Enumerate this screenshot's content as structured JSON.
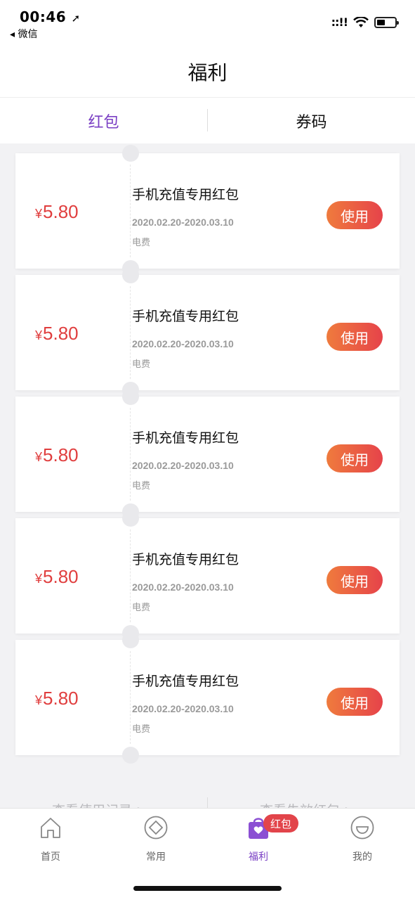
{
  "status_bar": {
    "time": "00:46",
    "location_arrow": "➚",
    "back_app": "◂ 微信",
    "signal": "::!!",
    "wifi": "wifi-icon",
    "battery": "battery-icon"
  },
  "header": {
    "title": "福利"
  },
  "tabs": [
    {
      "label": "红包",
      "active": true
    },
    {
      "label": "券码",
      "active": false
    }
  ],
  "coupons": [
    {
      "currency": "¥",
      "amount": "5.80",
      "title": "手机充值专用红包",
      "date_range": "2020.02.20-2020.03.10",
      "category": "电费",
      "action": "使用"
    },
    {
      "currency": "¥",
      "amount": "5.80",
      "title": "手机充值专用红包",
      "date_range": "2020.02.20-2020.03.10",
      "category": "电费",
      "action": "使用"
    },
    {
      "currency": "¥",
      "amount": "5.80",
      "title": "手机充值专用红包",
      "date_range": "2020.02.20-2020.03.10",
      "category": "电费",
      "action": "使用"
    },
    {
      "currency": "¥",
      "amount": "5.80",
      "title": "手机充值专用红包",
      "date_range": "2020.02.20-2020.03.10",
      "category": "电费",
      "action": "使用"
    },
    {
      "currency": "¥",
      "amount": "5.80",
      "title": "手机充值专用红包",
      "date_range": "2020.02.20-2020.03.10",
      "category": "电费",
      "action": "使用"
    }
  ],
  "bottom_links": {
    "left": "查看使用记录 >",
    "right": "查看失效红包 >"
  },
  "tabbar": {
    "items": [
      {
        "label": "首页",
        "icon": "home-icon",
        "active": false
      },
      {
        "label": "常用",
        "icon": "diamond-icon",
        "active": false
      },
      {
        "label": "福利",
        "icon": "gift-bag-icon",
        "active": true
      },
      {
        "label": "我的",
        "icon": "smile-face-icon",
        "active": false
      }
    ],
    "badge": "红包"
  },
  "colors": {
    "accent_purple": "#7a3fc4",
    "amount_red": "#e03e3e",
    "button_gradient_start": "#ef7b3d",
    "button_gradient_end": "#e6434a"
  }
}
